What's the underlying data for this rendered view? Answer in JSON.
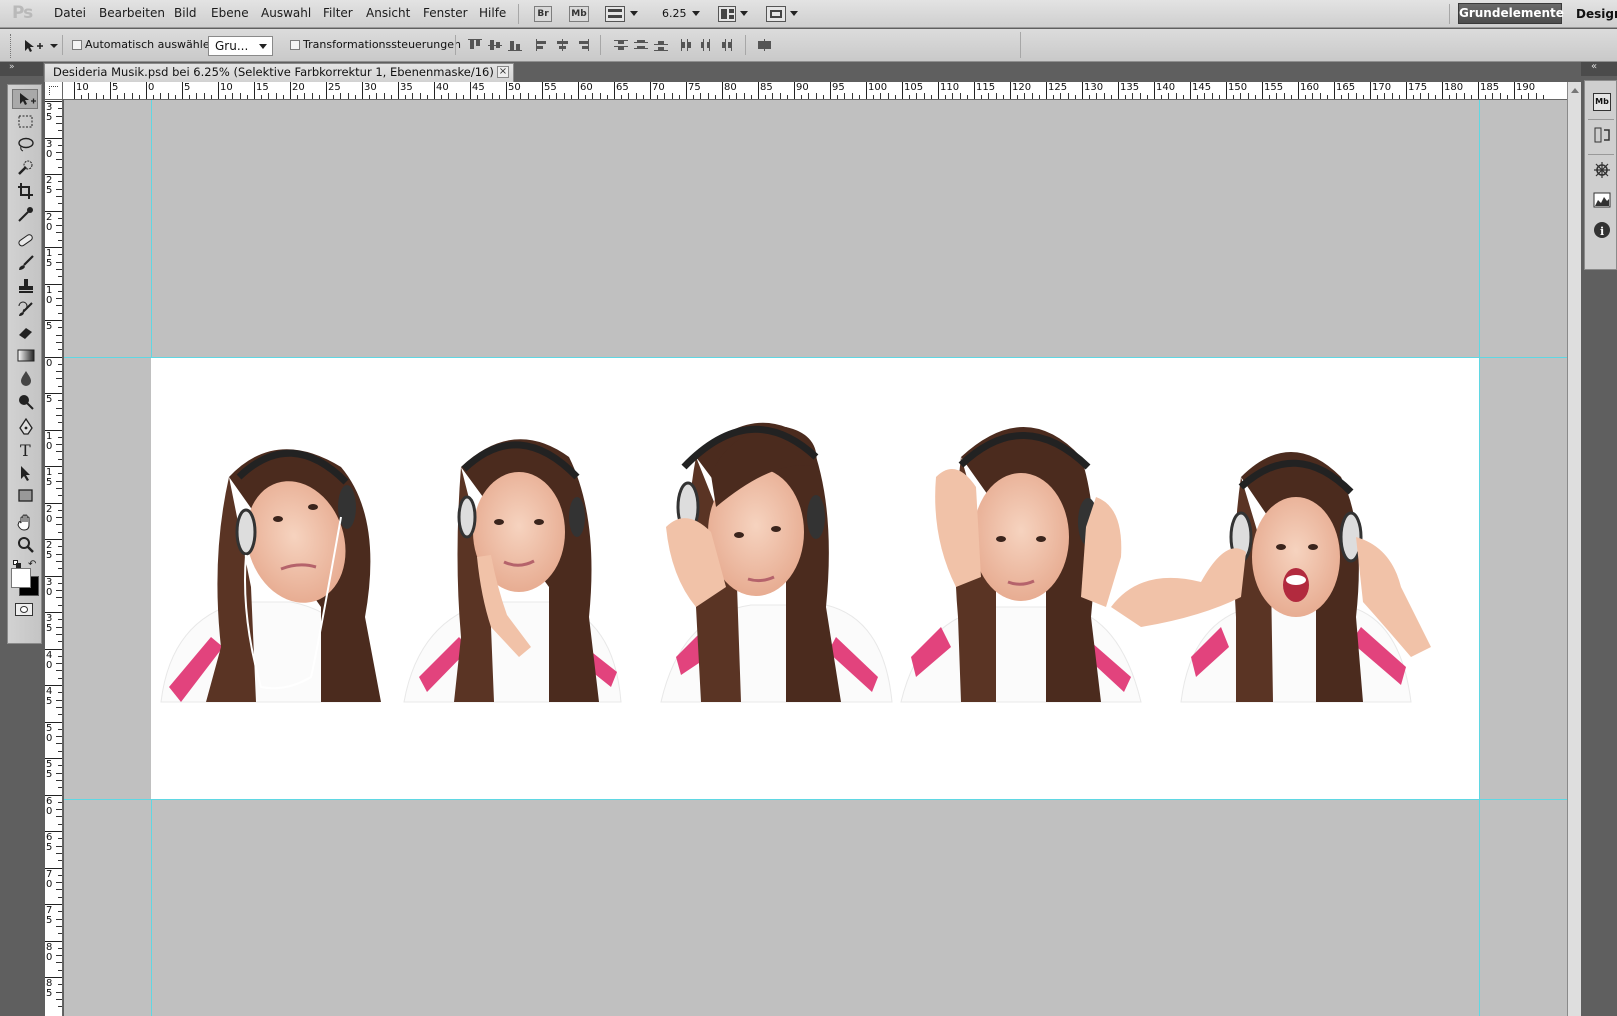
{
  "app": {
    "logo": "Ps",
    "menu": [
      "Datei",
      "Bearbeiten",
      "Bild",
      "Ebene",
      "Auswahl",
      "Filter",
      "Ansicht",
      "Fenster",
      "Hilfe"
    ],
    "bridge_label": "Br",
    "minibridge_label": "Mb",
    "zoom_level": "6.25",
    "workspace_active": "Grundelemente",
    "workspace_other": "Design"
  },
  "options_bar": {
    "auto_select_label": "Automatisch auswählen:",
    "auto_select_value": "Gru...",
    "transform_label": "Transformationssteuerungen"
  },
  "document": {
    "tab_title": "Desideria Musik.psd bei 6.25% (Selektive Farbkorrektur 1, Ebenenmaske/16) *",
    "close_glyph": "×"
  },
  "ruler_h": [
    "10",
    "5",
    "0",
    "5",
    "10",
    "15",
    "20",
    "25",
    "30",
    "35",
    "40",
    "45",
    "50",
    "55",
    "60",
    "65",
    "70",
    "75",
    "80",
    "85",
    "90",
    "95",
    "100",
    "105",
    "110",
    "115",
    "120",
    "125",
    "130",
    "135",
    "140",
    "145",
    "150",
    "155",
    "160",
    "165",
    "170",
    "175",
    "180",
    "185",
    "190"
  ],
  "ruler_v": [
    "3\n5",
    "3\n0",
    "2\n5",
    "2\n0",
    "1\n5",
    "1\n0",
    "5",
    "0",
    "5",
    "1\n0",
    "1\n5",
    "2\n0",
    "2\n5",
    "3\n0",
    "3\n5",
    "4\n0",
    "4\n5",
    "5\n0",
    "5\n5",
    "6\n0",
    "6\n5",
    "7\n0",
    "7\n5",
    "8\n0",
    "8\n5"
  ],
  "colors": {
    "guide": "#5fd7e3",
    "canvas_bg": "#c0c0c0",
    "shirt_pink": "#e0407a",
    "hair": "#4a2a1e",
    "skin": "#f1c2a8"
  }
}
